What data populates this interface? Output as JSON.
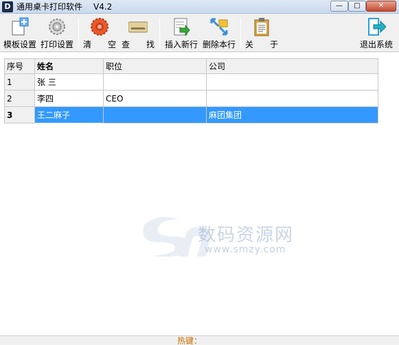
{
  "window": {
    "title": "通用桌卡打印软件",
    "version": "V4.2",
    "min_symbol": "—",
    "max_symbol": "□",
    "close_symbol": "✕"
  },
  "toolbar": {
    "buttons": [
      {
        "label": "模板设置",
        "icon": "template-add-icon"
      },
      {
        "label": "打印设置",
        "icon": "print-gear-icon"
      },
      {
        "label": "清　　空",
        "icon": "clear-icon"
      },
      {
        "label": "查　　找",
        "icon": "find-card-icon"
      },
      {
        "label": "插入新行",
        "icon": "insert-row-icon"
      },
      {
        "label": "删除本行",
        "icon": "delete-row-icon"
      },
      {
        "label": "关　　于",
        "icon": "clipboard-about-icon"
      },
      {
        "label": "退出系统",
        "icon": "exit-icon"
      }
    ]
  },
  "grid": {
    "columns": [
      "序号",
      "姓名",
      "职位",
      "公司"
    ],
    "rows": [
      {
        "index": "1",
        "name": "张  三",
        "position": "",
        "company": ""
      },
      {
        "index": "2",
        "name": "李四",
        "position": "CEO",
        "company": ""
      },
      {
        "index": "3",
        "name": "王二麻子",
        "position": "",
        "company": "麻团集团"
      }
    ],
    "selected_row": 3
  },
  "watermark": {
    "text": "数码资源网",
    "url": "www.smzy.com"
  },
  "statusbar": {
    "hotkey_label": "热键："
  },
  "colors": {
    "selection": "#3399ff",
    "hotkey": "#c87000"
  }
}
